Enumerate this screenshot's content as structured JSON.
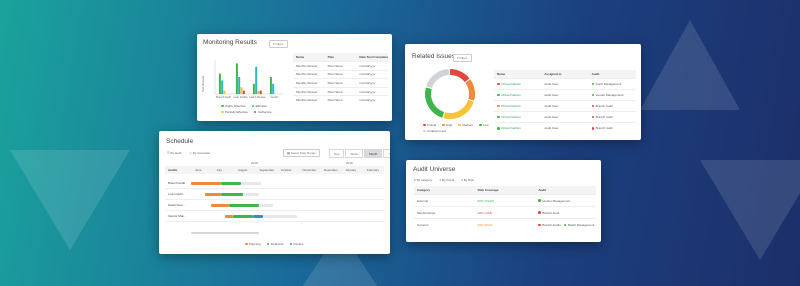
{
  "colors": {
    "green": "#3fb64b",
    "orange": "#f08a3a",
    "yellow": "#f5c43a",
    "red": "#e2463f",
    "teal": "#27b7c1",
    "blue": "#2f8fc8",
    "gray": "#e6e7ea"
  },
  "monitoring": {
    "title": "Monitoring Results",
    "filter_label": "Filters",
    "columns": [
      "Name",
      "Plan",
      "Date Test Completed"
    ],
    "rows": [
      [
        "Monthly Review",
        "Plan Name",
        "mm/dd/yyyy"
      ],
      [
        "Monthly Review",
        "Plan Name",
        "mm/dd/yyyy"
      ],
      [
        "Monthly Review",
        "Plan Name",
        "mm/dd/yyyy"
      ],
      [
        "Monthly Review",
        "Plan Name",
        "mm/dd/yyyy"
      ],
      [
        "Monthly Review",
        "Plan Name",
        "mm/dd/yyyy"
      ]
    ],
    "y_axis_label": "Test Results",
    "legend": [
      "Highly Effective",
      "Effective",
      "Partially Effective",
      "Ineffective"
    ],
    "chart_data": {
      "type": "bar",
      "categories": [
        "Branch Audit",
        "Loan Facility",
        "Hatch Review",
        "Vendor"
      ],
      "series": [
        {
          "name": "Highly Effective",
          "color": "#3fb64b",
          "values": [
            6,
            9,
            3,
            5
          ]
        },
        {
          "name": "Effective",
          "color": "#27b7c1",
          "values": [
            4,
            5,
            8,
            3
          ]
        },
        {
          "name": "Partially Effective",
          "color": "#f5c43a",
          "values": [
            1,
            2,
            1,
            0
          ]
        },
        {
          "name": "Ineffective",
          "color": "#e2463f",
          "values": [
            0,
            1,
            1,
            0
          ]
        }
      ],
      "ylim": [
        0,
        10
      ]
    }
  },
  "related": {
    "title": "Related Issues",
    "filter_label": "Filters",
    "columns": [
      "Name",
      "Assigned to",
      "Audit"
    ],
    "rows": [
      {
        "dot": "#e2463f",
        "name": "Virtual Fashion",
        "assigned": "Audit User",
        "audit_dot": "#3fb64b",
        "audit": "North Management"
      },
      {
        "dot": "#3fb64b",
        "name": "Virtual Fashion",
        "assigned": "Audit User",
        "audit_dot": "#3fb64b",
        "audit": "Vendor Management"
      },
      {
        "dot": "#f08a3a",
        "name": "Virtual Fashion",
        "assigned": "Audit User",
        "audit_dot": "#e2463f",
        "audit": "Branch Audit"
      },
      {
        "dot": "#3fb64b",
        "name": "Virtual Fashion",
        "assigned": "Audit User",
        "audit_dot": "#e2463f",
        "audit": "Branch Audit"
      },
      {
        "dot": "#3fb64b",
        "name": "Virtual Fashion",
        "assigned": "Audit User",
        "audit_dot": "#e2463f",
        "audit": "Branch Audit"
      }
    ],
    "legend": [
      {
        "label": "Critical",
        "color": "#e2463f"
      },
      {
        "label": "High",
        "color": "#f08a3a"
      },
      {
        "label": "Medium",
        "color": "#f5c43a"
      },
      {
        "label": "Low",
        "color": "#3fb64b"
      },
      {
        "label": "Undetermined",
        "color": "#cfd2d6"
      }
    ],
    "chart_data": {
      "type": "pie",
      "donut": true,
      "labels": [
        "Critical",
        "High",
        "Medium",
        "Low",
        "Undetermined"
      ],
      "values": [
        15,
        15,
        25,
        25,
        20
      ],
      "colors": [
        "#e2463f",
        "#f08a3a",
        "#f5c43a",
        "#3fb64b",
        "#cfd2d6"
      ]
    }
  },
  "schedule": {
    "title": "Schedule",
    "actions": [
      "By audit",
      "By Associate"
    ],
    "range_button": "Select Date Range",
    "views": [
      "Day",
      "Week",
      "Month",
      "Year"
    ],
    "active_view": "Month",
    "row_header": "Audits",
    "years": [
      "2018",
      "2019"
    ],
    "months": [
      "June",
      "July",
      "August",
      "September",
      "October",
      "November",
      "December",
      "January",
      "February"
    ],
    "rows": [
      "Branch Audit",
      "Loan Facili...",
      "Hatch Revi...",
      "Vendor Man..."
    ],
    "legend": [
      {
        "label": "Planning",
        "color": "#f08a3a"
      },
      {
        "label": "Fieldwork",
        "color": "#3fb64b"
      },
      {
        "label": "Review",
        "color": "#2f8fc8"
      }
    ]
  },
  "universe": {
    "title": "Audit Universe",
    "filters": [
      "By category",
      "By Fiscal",
      "By Risk"
    ],
    "columns": [
      "Category",
      "Risk Coverage",
      "Audit"
    ],
    "rows": [
      {
        "category": "External",
        "coverage": "80% (6/100)",
        "cov_color": "#3fb64b",
        "audits": [
          {
            "dot": "#3fb64b",
            "label": "Vendor Management"
          }
        ]
      },
      {
        "category": "Memberships",
        "coverage": "20% (1/18)",
        "cov_color": "#e2463f",
        "audits": [
          {
            "dot": "#e2463f",
            "label": "Branch Audit"
          }
        ]
      },
      {
        "category": "Systems",
        "coverage": "60% (6/10)",
        "cov_color": "#f08a3a",
        "audits": [
          {
            "dot": "#e2463f",
            "label": "Branch Audits"
          },
          {
            "dot": "#3fb64b",
            "label": "Match Management"
          }
        ]
      }
    ]
  }
}
